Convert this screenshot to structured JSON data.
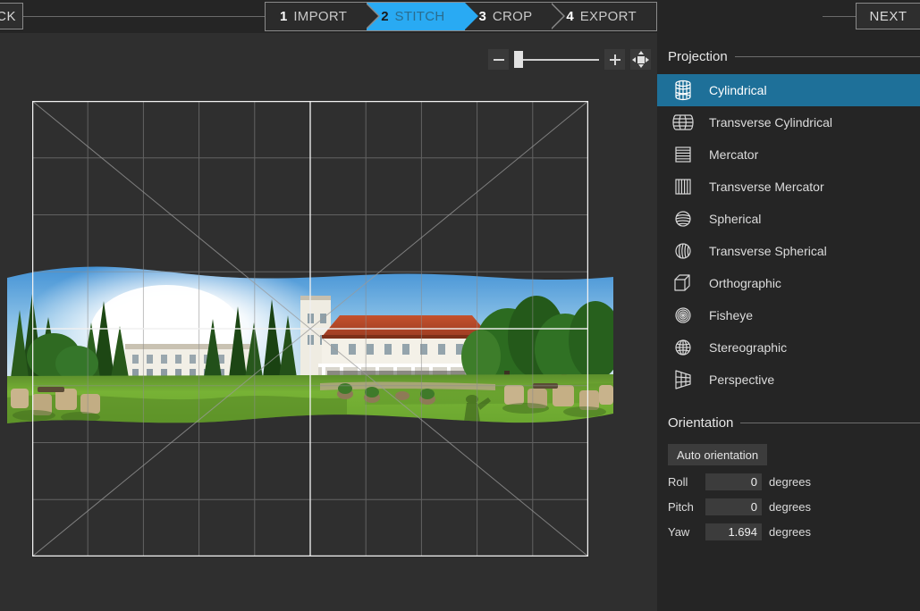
{
  "topbar": {
    "back_label": "CK",
    "next_label": "NEXT",
    "steps": [
      {
        "num": "1",
        "label": "IMPORT",
        "active": false
      },
      {
        "num": "2",
        "label": "STITCH",
        "active": true
      },
      {
        "num": "3",
        "label": "CROP",
        "active": false
      },
      {
        "num": "4",
        "label": "EXPORT",
        "active": false
      }
    ]
  },
  "toolbar": {
    "zoom_out_icon": "minus-icon",
    "zoom_in_icon": "plus-icon",
    "fit_icon": "fit-to-screen-icon",
    "zoom_value": 0
  },
  "canvas": {
    "grid_columns": 10,
    "grid_rows": 8,
    "diagonals": true,
    "crop_frame": true
  },
  "sidebar": {
    "projection": {
      "title": "Projection",
      "selected": "Cylindrical",
      "items": [
        {
          "label": "Cylindrical",
          "icon": "cylinder-grid-icon"
        },
        {
          "label": "Transverse Cylindrical",
          "icon": "transverse-cylinder-grid-icon"
        },
        {
          "label": "Mercator",
          "icon": "horizontal-lines-icon"
        },
        {
          "label": "Transverse Mercator",
          "icon": "vertical-lines-icon"
        },
        {
          "label": "Spherical",
          "icon": "sphere-horizontal-icon"
        },
        {
          "label": "Transverse Spherical",
          "icon": "sphere-vertical-icon"
        },
        {
          "label": "Orthographic",
          "icon": "cube-icon"
        },
        {
          "label": "Fisheye",
          "icon": "concentric-circles-icon"
        },
        {
          "label": "Stereographic",
          "icon": "globe-icon"
        },
        {
          "label": "Perspective",
          "icon": "trapezoid-grid-icon"
        }
      ]
    },
    "orientation": {
      "title": "Orientation",
      "auto_label": "Auto orientation",
      "fields": [
        {
          "label": "Roll",
          "value": "0",
          "unit": "degrees"
        },
        {
          "label": "Pitch",
          "value": "0",
          "unit": "degrees"
        },
        {
          "label": "Yaw",
          "value": "1.694",
          "unit": "degrees"
        }
      ]
    }
  },
  "colors": {
    "accent_blue": "#29aaf3",
    "selection_blue": "#1e7099",
    "topbar_bg": "#252525",
    "canvas_bg": "#2f2f2f",
    "sidebar_bg": "#252525"
  }
}
